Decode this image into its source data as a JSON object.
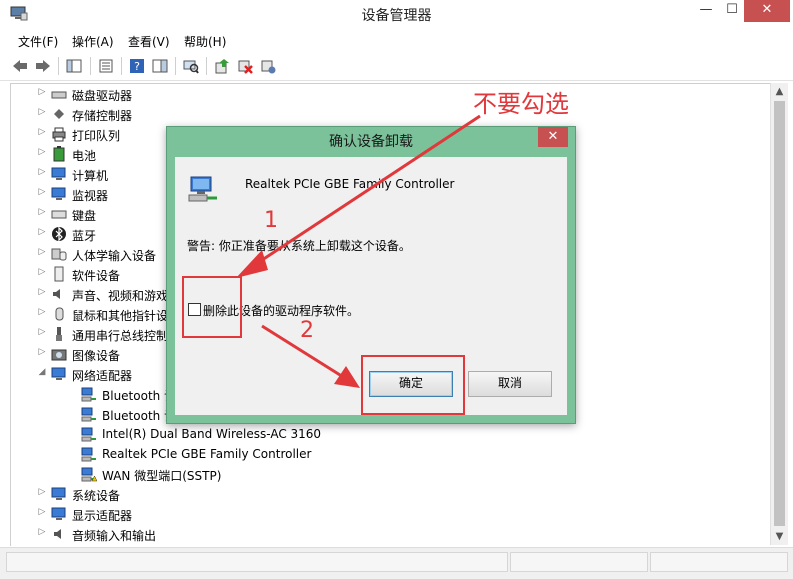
{
  "window": {
    "title": "设备管理器"
  },
  "menu": {
    "items": [
      "文件(F)",
      "操作(A)",
      "查看(V)",
      "帮助(H)"
    ]
  },
  "tree": {
    "items": [
      {
        "label": "磁盘驱动器",
        "expanded": false
      },
      {
        "label": "存储控制器",
        "expanded": false
      },
      {
        "label": "打印队列",
        "expanded": false
      },
      {
        "label": "电池",
        "expanded": false
      },
      {
        "label": "计算机",
        "expanded": false
      },
      {
        "label": "监视器",
        "expanded": false
      },
      {
        "label": "键盘",
        "expanded": false
      },
      {
        "label": "蓝牙",
        "expanded": false
      },
      {
        "label": "人体学输入设备",
        "expanded": false
      },
      {
        "label": "软件设备",
        "expanded": false
      },
      {
        "label": "声音、视频和游戏",
        "expanded": false
      },
      {
        "label": "鼠标和其他指针设",
        "expanded": false
      },
      {
        "label": "通用串行总线控制",
        "expanded": false
      },
      {
        "label": "图像设备",
        "expanded": false
      },
      {
        "label": "网络适配器",
        "expanded": true
      },
      {
        "label": "Bluetooth 设",
        "child": true
      },
      {
        "label": "Bluetooth 设",
        "child": true
      },
      {
        "label": "Intel(R) Dual Band Wireless-AC 3160",
        "child": true
      },
      {
        "label": "Realtek PCIe GBE Family Controller",
        "child": true
      },
      {
        "label": "WAN 微型端口(SSTP)",
        "child": true
      },
      {
        "label": "系统设备",
        "expanded": false
      },
      {
        "label": "显示适配器",
        "expanded": false
      },
      {
        "label": "音频输入和输出",
        "expanded": false
      }
    ]
  },
  "dialog": {
    "title": "确认设备卸载",
    "device_name": "Realtek PCIe GBE Family Controller",
    "warning": "警告: 你正准备要从系统上卸载这个设备。",
    "checkbox_label": "删除此设备的驱动程序软件。",
    "checkbox_checked": false,
    "ok_label": "确定",
    "cancel_label": "取消"
  },
  "annotations": {
    "note_text": "不要勾选",
    "step1": "1",
    "step2": "2",
    "color": "#e0383b"
  }
}
